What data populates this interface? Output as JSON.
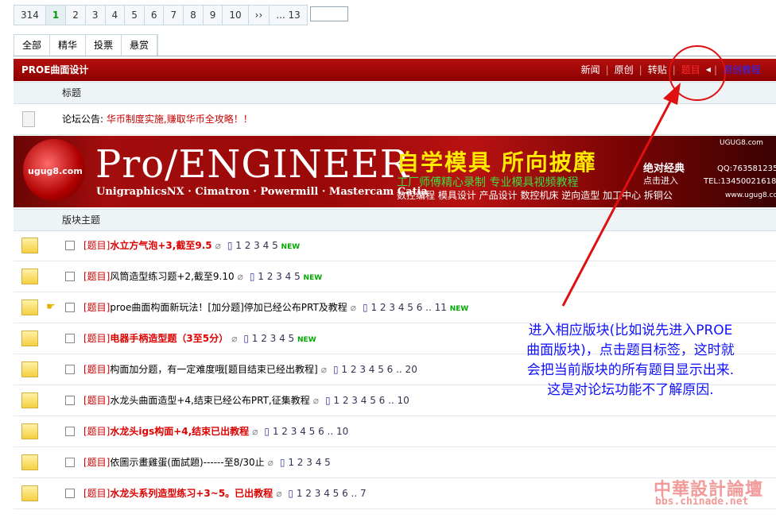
{
  "pager": {
    "pages": [
      "314",
      "1",
      "2",
      "3",
      "4",
      "5",
      "6",
      "7",
      "8",
      "9",
      "10",
      "››",
      "... 13"
    ],
    "current": "1"
  },
  "tabs": [
    "全部",
    "精华",
    "投票",
    "悬赏"
  ],
  "forum": {
    "title": "PROE曲面设计",
    "nav": [
      "新闻",
      "原创",
      "转贴",
      "题目",
      "原创教程"
    ],
    "nav_separator": "|"
  },
  "headers": {
    "topic": "标题",
    "board_topics": "版块主题"
  },
  "notice": {
    "lead": "论坛公告:",
    "link": "华币制度实施,赚取华币全攻略！！"
  },
  "banner": {
    "site": "UGUG8.com",
    "logo_text": "ugug8.com",
    "pro": "Pro/ENGINEER",
    "sub": "UnigraphicsNX · Cimatron · Powermill · Mastercam  Catia",
    "slogan": "自学模具 所向披靡",
    "line2": "工厂师傅精心录制  专业模具视频教程",
    "line3": "数控编程  模具设计  产品设计  数控机床  逆向造型  加工中心  拆铜公",
    "jd": "绝对经典",
    "dj": "点击进入",
    "qq": "QQ:763581235",
    "tel": "TEL:13450021618",
    "www": "www.ugug8.com"
  },
  "threads": [
    {
      "tag": "[题目]",
      "title": "水立方气泡+3,截至9.5",
      "hot": true,
      "pages": "1  2  3  4  5",
      "new": "NEW",
      "hand": false
    },
    {
      "tag": "[题目]",
      "title": "风筒造型练习题+2,截至9.10",
      "hot": false,
      "pages": "1  2  3  4  5",
      "new": "NEW",
      "hand": false
    },
    {
      "tag": "[题目]",
      "title": "proe曲面构面新玩法！[加分题]停加已经公布PRT及教程",
      "hot": false,
      "pages": "1  2  3  4  5  6 ..  11",
      "new": "NEW",
      "hand": true
    },
    {
      "tag": "[题目]",
      "title": "电器手柄造型题（3至5分）",
      "hot": true,
      "pages": "1  2  3  4  5",
      "new": "NEW",
      "hand": false
    },
    {
      "tag": "[题目]",
      "title": "构面加分题，有一定难度哦[题目结束已经出教程]",
      "hot": false,
      "pages": "1  2  3  4  5  6 ..  20",
      "new": "",
      "hand": false
    },
    {
      "tag": "[题目]",
      "title": "水龙头曲面造型+4,结束已经公布PRT,征集教程",
      "hot": false,
      "pages": "1  2  3  4  5  6 ..  10",
      "new": "",
      "hand": false
    },
    {
      "tag": "[题目]",
      "title": "水龙头igs构面+4,结束已出教程",
      "hot": true,
      "pages": "1  2  3  4  5  6 ..  10",
      "new": "",
      "hand": false
    },
    {
      "tag": "[题目]",
      "title": "依圖示畫雞蛋(面試題)------至8/30止",
      "hot": false,
      "pages": "1  2  3  4  5",
      "new": "",
      "hand": false
    },
    {
      "tag": "[题目]",
      "title": "水龙头系列造型练习+3~5。已出教程",
      "hot": true,
      "pages": "1  2  3  4  5  6 ..  7",
      "new": "",
      "hand": false
    }
  ],
  "callout": [
    "进入相应版块(比如说先进入PROE",
    "曲面版块)，点击题目标签，这时就",
    "会把当前版块的所有题目显示出来.",
    "这是对论坛功能不了解原因."
  ],
  "watermark": {
    "cn": "中華設計論壇",
    "url": "bbs.chinade.net"
  },
  "colors": {
    "header_red": "#a00a0a",
    "tag_red": "#cc0000",
    "annotation_red": "#e01010",
    "callout_blue": "#1010ff"
  }
}
